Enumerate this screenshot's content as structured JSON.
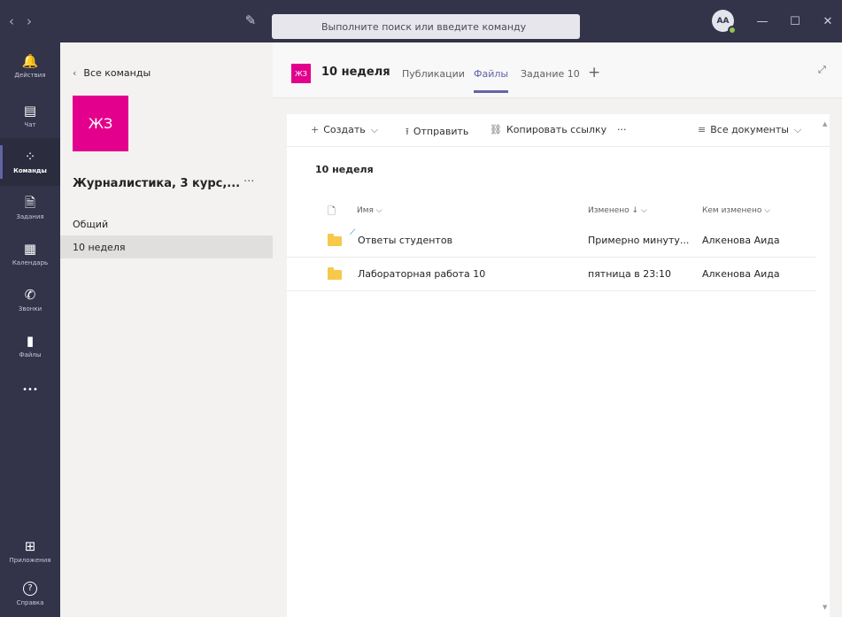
{
  "titlebar": {
    "back": "‹",
    "forward": "›",
    "search_placeholder": "Выполните поиск или введите команду",
    "avatar": "AA",
    "minimize": "—",
    "maximize": "☐",
    "close": "✕"
  },
  "rail": [
    {
      "label": "Действия",
      "icon": "bell-icon",
      "glyph": "🔔"
    },
    {
      "label": "Чат",
      "icon": "chat-icon",
      "glyph": "▤"
    },
    {
      "label": "Команды",
      "icon": "teams-icon",
      "glyph": "⁘"
    },
    {
      "label": "Задания",
      "icon": "assignments-icon",
      "glyph": "🗎"
    },
    {
      "label": "Календарь",
      "icon": "calendar-icon",
      "glyph": "▦"
    },
    {
      "label": "Звонки",
      "icon": "phone-icon",
      "glyph": "✆"
    },
    {
      "label": "Файлы",
      "icon": "files-icon",
      "glyph": "▮"
    },
    {
      "label": "",
      "icon": "more-icon",
      "glyph": "•••"
    },
    {
      "label": "Приложения",
      "icon": "apps-icon",
      "glyph": "⊞"
    },
    {
      "label": "Справка",
      "icon": "help-icon",
      "glyph": "?"
    }
  ],
  "teams_panel": {
    "back_label": "Все команды",
    "team_initials": "ЖЗ",
    "team_name": "Журналистика, 3 курс,...",
    "more": "···",
    "channels": [
      "Общий",
      "10 неделя"
    ]
  },
  "header": {
    "logo": "ЖЗ",
    "title": "10 неделя",
    "tabs": [
      "Публикации",
      "Файлы",
      "Задание 10"
    ],
    "active_tab": "Файлы",
    "add": "+",
    "expand": "⤢"
  },
  "commands": {
    "create": "Создать",
    "upload": "Отправить",
    "copy_link": "Копировать ссылку",
    "more": "···",
    "view": "Все документы"
  },
  "files": {
    "folder_title": "10 неделя",
    "columns": {
      "name": "Имя",
      "modified": "Изменено",
      "modified_by": "Кем изменено"
    },
    "rows": [
      {
        "name": "Ответы студентов",
        "modified": "Примерно минуту...",
        "modified_by": "Алкенова Аида"
      },
      {
        "name": "Лабораторная работа 10",
        "modified": "пятница в 23:10",
        "modified_by": "Алкенова Аида"
      }
    ]
  },
  "colors": {
    "accent": "#6264a7",
    "team": "#e3008c",
    "rail": "#33344a",
    "folder": "#f6c94b"
  }
}
